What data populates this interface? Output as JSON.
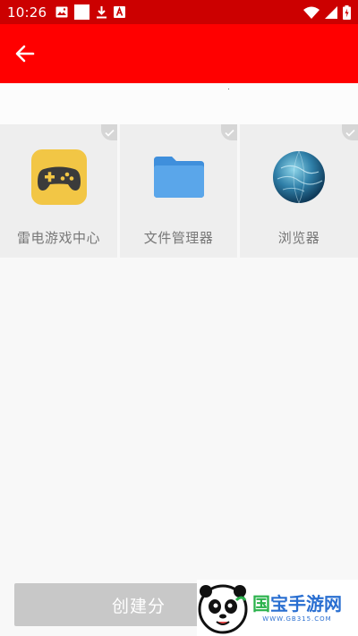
{
  "status_bar": {
    "time": "10:26",
    "left_icons": [
      "image-icon",
      "square-notification-icon",
      "download-icon",
      "a-notification-icon"
    ],
    "right_icons": [
      "wifi-icon",
      "signal-icon",
      "battery-charging-icon"
    ],
    "background": "#cc0000"
  },
  "toolbar": {
    "back_icon": "arrow-left-icon",
    "background": "#ff0000"
  },
  "apps": [
    {
      "label": "雷电游戏中心",
      "icon": "gamepad-icon",
      "checked": false
    },
    {
      "label": "文件管理器",
      "icon": "folder-icon",
      "checked": false
    },
    {
      "label": "浏览器",
      "icon": "globe-icon",
      "checked": false
    }
  ],
  "create_button": {
    "label": "创建分"
  },
  "watermark": {
    "title_parts": [
      "国",
      "宝",
      "手游网"
    ],
    "url": "WWW.GB315.COM"
  }
}
